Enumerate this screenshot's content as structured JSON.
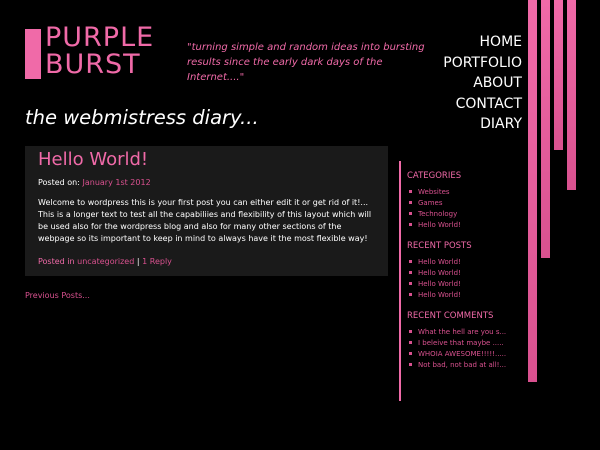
{
  "logo": {
    "line1": "PURPLE",
    "line2": "BURST"
  },
  "tagline": "\"turning simple and random ideas into bursting results since the early dark days of the Internet....\"",
  "nav": {
    "items": [
      "HOME",
      "PORTFOLIO",
      "ABOUT",
      "CONTACT",
      "DIARY"
    ]
  },
  "subtitle": "the webmistress diary...",
  "post": {
    "title": "Hello World!",
    "posted_on_label": "Posted on:",
    "date": "January 1st 2012",
    "body": "Welcome to wordpress this is your first post you can either edit it or get rid of it!... This is a longer text to test all the capabiliies and flexibility of this layout which will be used also for the wordpress blog and also for many other sections of the webpage so its important to keep in mind to always have it the most flexible way!",
    "posted_in_label": "Posted in",
    "category": "uncategorized",
    "separator": "|",
    "replies": "1 Reply"
  },
  "previous_posts": "Previous Posts...",
  "sidebar": {
    "categories": {
      "title": "CATEGORIES",
      "items": [
        "Websites",
        "Games",
        "Technology",
        "Hello World!"
      ]
    },
    "recent_posts": {
      "title": "RECENT POSTS",
      "items": [
        "Hello World!",
        "Hello World!",
        "Hello World!",
        "Hello World!"
      ]
    },
    "recent_comments": {
      "title": "RECENT COMMENTS",
      "items": [
        "What the hell are you s...",
        "I beleive that maybe .....",
        "WHOIA AWESOME!!!!!.....",
        "Not bad, not bad at all!..."
      ]
    }
  },
  "colors": {
    "accent": "#f06aa8",
    "accent_dark": "#d9518f",
    "background": "#000000",
    "post_bg": "#1a1a1a"
  }
}
